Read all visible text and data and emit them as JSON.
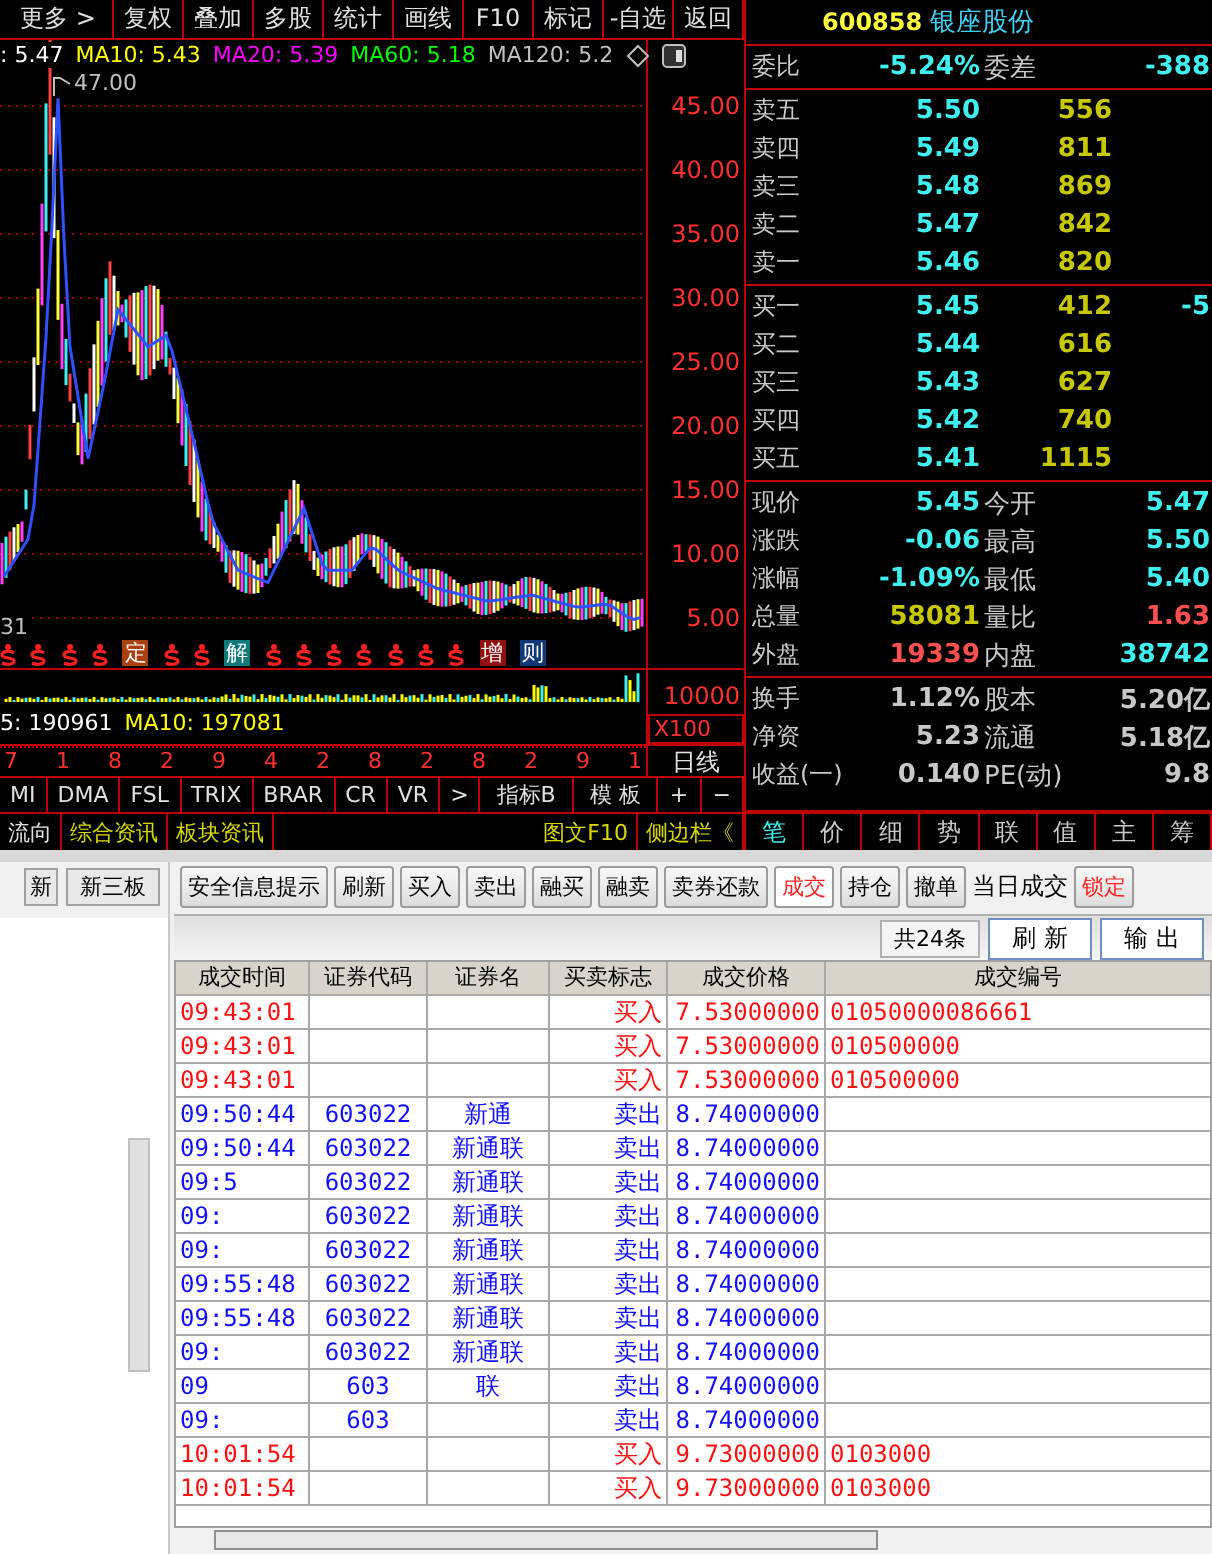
{
  "toolbar": {
    "items": [
      "更多 >",
      "复权",
      "叠加",
      "多股",
      "统计",
      "画线",
      "F10",
      "标记",
      "-自选",
      "返回"
    ]
  },
  "price_chart": {
    "legend": [
      {
        "label": ": 5.47",
        "color": "#ffffff"
      },
      {
        "label": "MA10: 5.43",
        "color": "#ffff00"
      },
      {
        "label": "MA20: 5.39",
        "color": "#ff00ff"
      },
      {
        "label": "MA60: 5.18",
        "color": "#00ff00"
      },
      {
        "label": "MA120: 5.2",
        "color": "#c0c0c0"
      }
    ],
    "peak_label": "47.00",
    "low_label": "31",
    "y_labels": [
      "45.00",
      "40.00",
      "35.00",
      "30.00",
      "25.00",
      "20.00",
      "15.00",
      "10.00",
      "5.00"
    ],
    "markers": [
      {
        "kind": "dollar"
      },
      {
        "kind": "dollar"
      },
      {
        "kind": "dollar"
      },
      {
        "kind": "dollar"
      },
      {
        "kind": "tag",
        "text": "定",
        "color": "#a84010"
      },
      {
        "kind": "dollar"
      },
      {
        "kind": "dollar"
      },
      {
        "kind": "tag",
        "text": "解",
        "color": "#107878"
      },
      {
        "kind": "dollar"
      },
      {
        "kind": "dollar"
      },
      {
        "kind": "dollar"
      },
      {
        "kind": "dollar"
      },
      {
        "kind": "dollar"
      },
      {
        "kind": "dollar"
      },
      {
        "kind": "dollar"
      },
      {
        "kind": "tag",
        "text": "增",
        "color": "#901010"
      },
      {
        "kind": "tag",
        "text": "则",
        "color": "#103878"
      }
    ]
  },
  "volume_chart": {
    "legend": [
      {
        "label": "5: 190961",
        "color": "#ffffff"
      },
      {
        "label": "MA10: 197081",
        "color": "#ffff00"
      }
    ],
    "y_label": "10000",
    "unit": "X100"
  },
  "time_axis": {
    "labels": [
      "7",
      "1",
      "8",
      "2",
      "9",
      "4",
      "2",
      "8",
      "2",
      "8",
      "2",
      "9",
      "1"
    ],
    "period": "日线"
  },
  "indicator_tabs": {
    "items": [
      "MI",
      "DMA",
      "FSL",
      "TRIX",
      "BRAR",
      "CR",
      "VR",
      ">"
    ],
    "extra": [
      "指标B",
      "模 板"
    ],
    "zoom": [
      "+",
      "−"
    ]
  },
  "info_tabs": {
    "left": [
      "流向",
      "综合资讯",
      "板块资讯"
    ],
    "right": [
      "图文F10",
      "侧边栏《"
    ]
  },
  "quote": {
    "code": "600858",
    "name": "银座股份",
    "ratio": [
      {
        "label": "委比",
        "value": "-5.24%"
      },
      {
        "label": "委差",
        "value": "-388"
      }
    ],
    "sell": [
      {
        "label": "卖五",
        "price": "5.50",
        "volume": "556"
      },
      {
        "label": "卖四",
        "price": "5.49",
        "volume": "811"
      },
      {
        "label": "卖三",
        "price": "5.48",
        "volume": "869"
      },
      {
        "label": "卖二",
        "price": "5.47",
        "volume": "842"
      },
      {
        "label": "卖一",
        "price": "5.46",
        "volume": "820"
      }
    ],
    "buy": [
      {
        "label": "买一",
        "price": "5.45",
        "volume": "412",
        "change": "-5"
      },
      {
        "label": "买二",
        "price": "5.44",
        "volume": "616"
      },
      {
        "label": "买三",
        "price": "5.43",
        "volume": "627"
      },
      {
        "label": "买四",
        "price": "5.42",
        "volume": "740"
      },
      {
        "label": "买五",
        "price": "5.41",
        "volume": "1115"
      }
    ],
    "stats": [
      [
        {
          "label": "现价",
          "value": "5.45",
          "color": "#40f0f0"
        },
        {
          "label": "今开",
          "value": "5.47",
          "color": "#40f0f0"
        }
      ],
      [
        {
          "label": "涨跌",
          "value": "-0.06",
          "color": "#40f0f0"
        },
        {
          "label": "最高",
          "value": "5.50",
          "color": "#40f0f0"
        }
      ],
      [
        {
          "label": "涨幅",
          "value": "-1.09%",
          "color": "#40f0f0"
        },
        {
          "label": "最低",
          "value": "5.40",
          "color": "#40f0f0"
        }
      ],
      [
        {
          "label": "总量",
          "value": "58081",
          "color": "#c8c800"
        },
        {
          "label": "量比",
          "value": "1.63",
          "color": "#ff5050"
        }
      ],
      [
        {
          "label": "外盘",
          "value": "19339",
          "color": "#ff5050"
        },
        {
          "label": "内盘",
          "value": "38742",
          "color": "#40f0f0"
        }
      ]
    ],
    "finance": [
      [
        {
          "label": "换手",
          "value": "1.12%"
        },
        {
          "label": "股本",
          "value": "5.20亿"
        }
      ],
      [
        {
          "label": "净资",
          "value": "5.23"
        },
        {
          "label": "流通",
          "value": "5.18亿"
        }
      ],
      [
        {
          "label": "收益(一)",
          "value": "0.140"
        },
        {
          "label": "PE(动)",
          "value": "9.8"
        }
      ]
    ],
    "tabs": [
      {
        "label": "笔",
        "selected": true
      },
      {
        "label": "价",
        "selected": false
      },
      {
        "label": "细",
        "selected": false
      },
      {
        "label": "势",
        "selected": false
      },
      {
        "label": "联",
        "selected": false
      },
      {
        "label": "值",
        "selected": false
      },
      {
        "label": "主",
        "selected": false
      },
      {
        "label": "筹",
        "selected": false
      }
    ]
  },
  "side_panel": {
    "tabs": [
      "新",
      "新三板"
    ]
  },
  "trade": {
    "buttons": [
      {
        "label": "安全信息提示",
        "selected": false
      },
      {
        "label": "刷新",
        "selected": false
      },
      {
        "label": "买入",
        "selected": false
      },
      {
        "label": "卖出",
        "selected": false
      },
      {
        "label": "融买",
        "selected": false
      },
      {
        "label": "融卖",
        "selected": false
      },
      {
        "label": "卖券还款",
        "selected": false
      },
      {
        "label": "成交",
        "selected": true
      },
      {
        "label": "持仓",
        "selected": false
      },
      {
        "label": "撤单",
        "selected": false
      }
    ],
    "view_title": "当日成交",
    "lock_button": "锁定",
    "count": "共24条",
    "refresh": "刷 新",
    "export": "输 出",
    "columns": [
      "成交时间",
      "证券代码",
      "证券名",
      "买卖标志",
      "成交价格",
      "成交编号"
    ],
    "rows": [
      {
        "kind": "buy",
        "cells": [
          "09:43:01",
          "",
          "",
          "买入",
          "7.53000000",
          "01050000086661"
        ]
      },
      {
        "kind": "buy",
        "cells": [
          "09:43:01",
          "",
          "",
          "买入",
          "7.53000000",
          "010500000"
        ]
      },
      {
        "kind": "buy",
        "cells": [
          "09:43:01",
          "",
          "",
          "买入",
          "7.53000000",
          "010500000"
        ]
      },
      {
        "kind": "sell",
        "cells": [
          "09:50:44",
          "603022",
          "新通",
          "卖出",
          "8.74000000",
          ""
        ]
      },
      {
        "kind": "sell",
        "cells": [
          "09:50:44",
          "603022",
          "新通联",
          "卖出",
          "8.74000000",
          ""
        ]
      },
      {
        "kind": "sell",
        "cells": [
          "09:5",
          "603022",
          "新通联",
          "卖出",
          "8.74000000",
          ""
        ]
      },
      {
        "kind": "sell",
        "cells": [
          "09:",
          "603022",
          "新通联",
          "卖出",
          "8.74000000",
          ""
        ]
      },
      {
        "kind": "sell",
        "cells": [
          "09:",
          "603022",
          "新通联",
          "卖出",
          "8.74000000",
          ""
        ]
      },
      {
        "kind": "sell",
        "cells": [
          "09:55:48",
          "603022",
          "新通联",
          "卖出",
          "8.74000000",
          ""
        ]
      },
      {
        "kind": "sell",
        "cells": [
          "09:55:48",
          "603022",
          "新通联",
          "卖出",
          "8.74000000",
          ""
        ]
      },
      {
        "kind": "sell",
        "cells": [
          "09:",
          "603022",
          "新通联",
          "卖出",
          "8.74000000",
          ""
        ]
      },
      {
        "kind": "sell",
        "cells": [
          "09",
          "603",
          "联",
          "卖出",
          "8.74000000",
          ""
        ]
      },
      {
        "kind": "sell",
        "cells": [
          "09:",
          "603",
          "",
          "卖出",
          "8.74000000",
          ""
        ]
      },
      {
        "kind": "buy",
        "cells": [
          "10:01:54",
          "",
          "",
          "买入",
          "9.73000000",
          "0103000"
        ]
      },
      {
        "kind": "buy",
        "cells": [
          "10:01:54",
          "",
          "",
          "买入",
          "9.73000000",
          "0103000"
        ]
      }
    ]
  }
}
